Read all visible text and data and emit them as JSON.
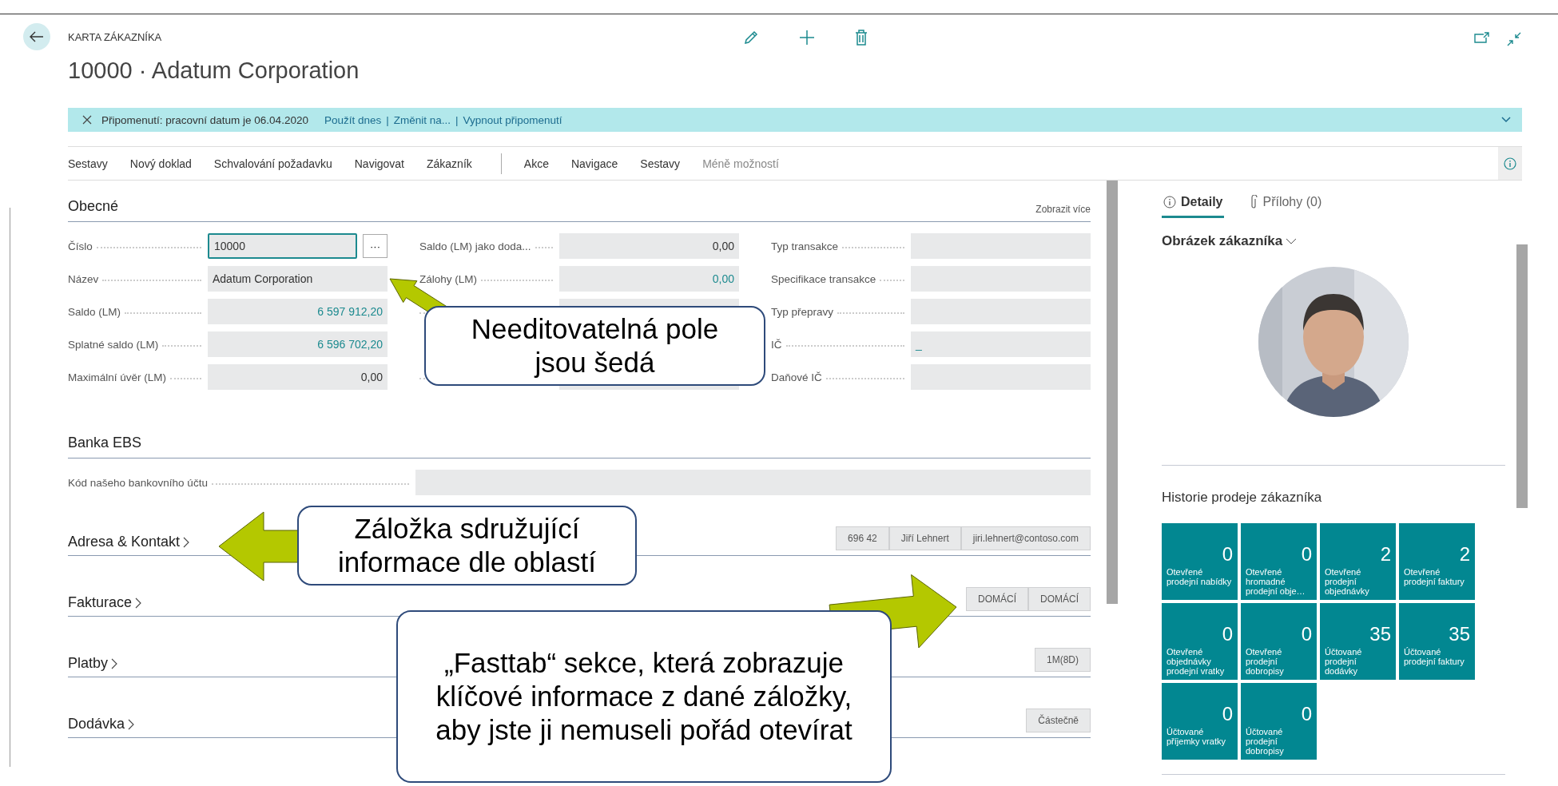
{
  "header": {
    "caption": "KARTA ZÁKAZNÍKA",
    "title": "10000 · Adatum Corporation"
  },
  "notification": {
    "text": "Připomenutí: pracovní datum je 06.04.2020",
    "links": [
      "Použít dnes",
      "Změnit na...",
      "Vypnout připomenutí"
    ],
    "separator": "|"
  },
  "actions": [
    "Sestavy",
    "Nový doklad",
    "Schvalování požadavku",
    "Navigovat",
    "Zákazník"
  ],
  "more_actions": [
    "Akce",
    "Navigace",
    "Sestavy"
  ],
  "less_options": "Méně možností",
  "general": {
    "title": "Obecné",
    "show_more": "Zobrazit více",
    "columns": [
      [
        {
          "label": "Číslo",
          "value": "10000",
          "kind": "editable",
          "lookup": "···"
        },
        {
          "label": "Název",
          "value": "Adatum Corporation",
          "kind": "text"
        },
        {
          "label": "Saldo (LM)",
          "value": "6 597 912,20",
          "kind": "link-number"
        },
        {
          "label": "Splatné saldo (LM)",
          "value": "6 596 702,20",
          "kind": "link-number"
        },
        {
          "label": "Maximální úvěr (LM)",
          "value": "0,00",
          "kind": "number"
        }
      ],
      [
        {
          "label": "Saldo (LM) jako doda...",
          "value": "0,00",
          "kind": "number"
        },
        {
          "label": "Zálohy (LM)",
          "value": "0,00",
          "kind": "link-number"
        },
        {
          "kind": "number"
        },
        {
          "kind": "number"
        }
      ],
      [
        {
          "label": "Typ transakce",
          "kind": "text"
        },
        {
          "label": "Specifikace transakce",
          "kind": "text"
        },
        {
          "label": "Typ přepravy",
          "kind": "text"
        },
        {
          "label": "IČ",
          "value": "_",
          "kind": "link-text"
        },
        {
          "label": "Daňové IČ",
          "kind": "text"
        }
      ]
    ]
  },
  "bank": {
    "title": "Banka EBS",
    "field": {
      "label": "Kód našeho bankovního účtu",
      "kind": "text"
    }
  },
  "fasttabs": [
    {
      "title": "Adresa & Kontakt",
      "summary": [
        "696 42",
        "Jiří Lehnert",
        "jiri.lehnert@contoso.com"
      ]
    },
    {
      "title": "Fakturace",
      "summary": [
        "DOMÁCÍ",
        "DOMÁCÍ"
      ]
    },
    {
      "title": "Platby",
      "summary": [
        "1M(8D)"
      ]
    },
    {
      "title": "Dodávka",
      "summary": [
        "Částečně"
      ]
    }
  ],
  "factbox": {
    "tabs": [
      {
        "label": "Detaily",
        "selected": true
      },
      {
        "label": "Přílohy (0)",
        "selected": false
      }
    ],
    "picture_title": "Obrázek zákazníka",
    "history_title": "Historie prodeje zákazníka",
    "tiles": [
      {
        "value": "0",
        "label": "Otevřené prodejní nabídky"
      },
      {
        "value": "0",
        "label": "Otevřené hromadné prodejní obje…"
      },
      {
        "value": "2",
        "label": "Otevřené prodejní objednávky"
      },
      {
        "value": "2",
        "label": "Otevřené prodejní faktury"
      },
      {
        "value": "0",
        "label": "Otevřené objednávky prodejní vratky"
      },
      {
        "value": "0",
        "label": "Otevřené prodejní dobropisy"
      },
      {
        "value": "35",
        "label": "Účtované prodejní dodávky"
      },
      {
        "value": "35",
        "label": "Účtované prodejní faktury"
      },
      {
        "value": "0",
        "label": "Účtované příjemky vratky"
      },
      {
        "value": "0",
        "label": "Účtované prodejní dobropisy"
      }
    ]
  },
  "callouts": [
    {
      "text": "Needitovatelná pole jsou šedá",
      "kind": "up-left"
    },
    {
      "text": "Záložka sdružující informace dle oblastí",
      "kind": "left"
    },
    {
      "text": "„Fasttab“ sekce, která zobrazuje klíčové informace z dané záložky, aby jste ji nemuseli pořád otevírat",
      "kind": "right"
    }
  ]
}
